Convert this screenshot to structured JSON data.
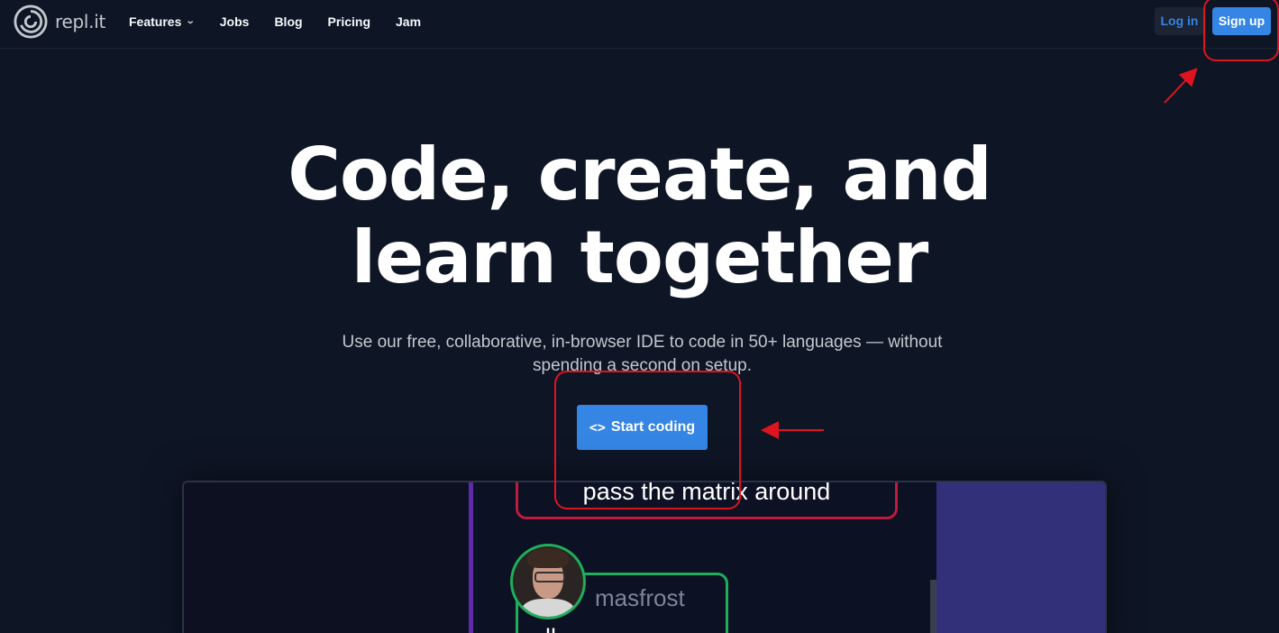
{
  "nav": {
    "logo_text": "repl.it",
    "links": [
      {
        "label": "Features",
        "has_dropdown": true
      },
      {
        "label": "Jobs"
      },
      {
        "label": "Blog"
      },
      {
        "label": "Pricing"
      },
      {
        "label": "Jam"
      }
    ],
    "login_label": "Log in",
    "signup_label": "Sign up"
  },
  "hero": {
    "title_line1": "Code, create, and",
    "title_line2": "learn together",
    "subtitle": "Use our free, collaborative, in-browser IDE to code in 50+ languages — without spending a second on setup.",
    "cta_icon": "<>",
    "cta_label": "Start coding"
  },
  "video": {
    "message_text": "pass the matrix around",
    "username": "masfrost",
    "message2_text": "ll ........"
  },
  "colors": {
    "background": "#0e1525",
    "accent_blue": "#3485e4",
    "annotation_red": "#e0141e"
  },
  "icons": {
    "logo": "replit-logo-icon",
    "dropdown": "chevron-down-icon",
    "code": "code-brackets-icon"
  }
}
